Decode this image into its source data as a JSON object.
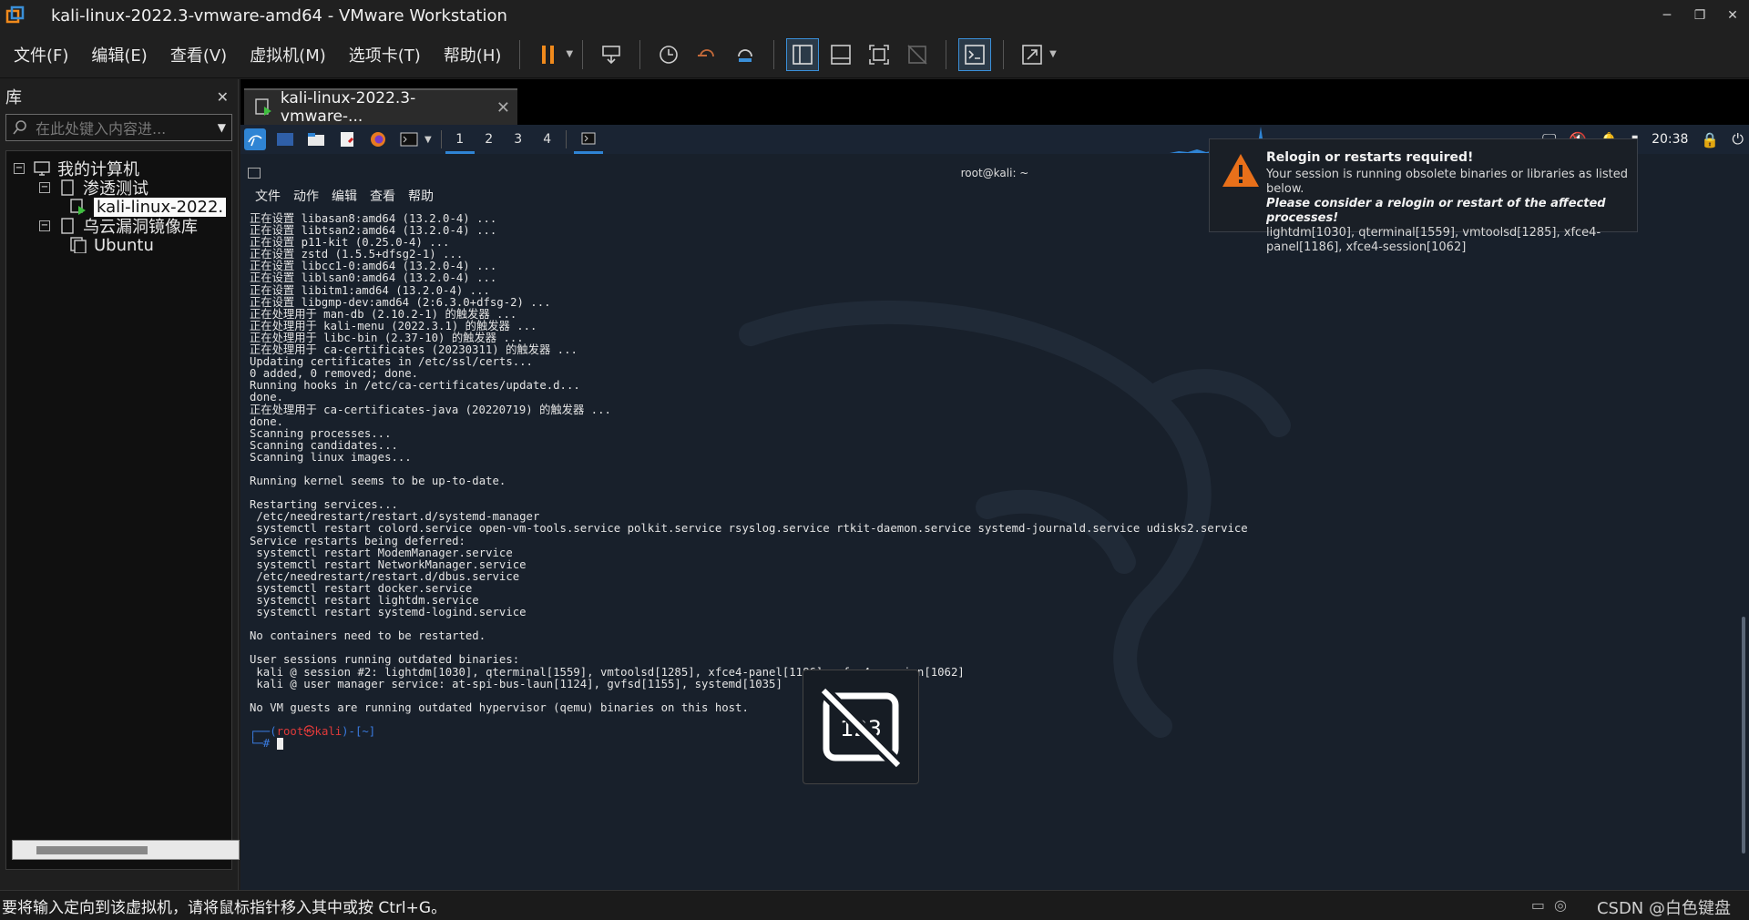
{
  "window": {
    "title": "kali-linux-2022.3-vmware-amd64 - VMware Workstation",
    "controls": [
      "minimize-icon",
      "restore-icon",
      "close-icon"
    ]
  },
  "menu": {
    "file": "文件(F)",
    "edit": "编辑(E)",
    "view": "查看(V)",
    "vm": "虚拟机(M)",
    "tabs": "选项卡(T)",
    "help": "帮助(H)"
  },
  "library": {
    "title": "库",
    "close": "✕",
    "search_placeholder": "在此处键入内容进...",
    "tree": {
      "root": "我的计算机",
      "folder1": "渗透测试",
      "vm1": "kali-linux-2022.",
      "folder2": "乌云漏洞镜像库",
      "vm2": "Ubuntu"
    }
  },
  "vm_tab": {
    "label": "kali-linux-2022.3-vmware-...",
    "close": "✕"
  },
  "kali_panel": {
    "workspaces": [
      "1",
      "2",
      "3",
      "4"
    ],
    "clock": "20:38"
  },
  "terminal": {
    "title": "root@kali: ~",
    "menu": [
      "文件",
      "动作",
      "编辑",
      "查看",
      "帮助"
    ],
    "lines": [
      "正在设置 libasan8:amd64 (13.2.0-4) ...",
      "正在设置 libtsan2:amd64 (13.2.0-4) ...",
      "正在设置 p11-kit (0.25.0-4) ...",
      "正在设置 zstd (1.5.5+dfsg2-1) ...",
      "正在设置 libcc1-0:amd64 (13.2.0-4) ...",
      "正在设置 liblsan0:amd64 (13.2.0-4) ...",
      "正在设置 libitm1:amd64 (13.2.0-4) ...",
      "正在设置 libgmp-dev:amd64 (2:6.3.0+dfsg-2) ...",
      "正在处理用于 man-db (2.10.2-1) 的触发器 ...",
      "正在处理用于 kali-menu (2022.3.1) 的触发器 ...",
      "正在处理用于 libc-bin (2.37-10) 的触发器 ...",
      "正在处理用于 ca-certificates (20230311) 的触发器 ...",
      "Updating certificates in /etc/ssl/certs...",
      "0 added, 0 removed; done.",
      "Running hooks in /etc/ca-certificates/update.d...",
      "done.",
      "正在处理用于 ca-certificates-java (20220719) 的触发器 ...",
      "done.",
      "Scanning processes...",
      "Scanning candidates...",
      "Scanning linux images...",
      "",
      "Running kernel seems to be up-to-date.",
      "",
      "Restarting services...",
      " /etc/needrestart/restart.d/systemd-manager",
      " systemctl restart colord.service open-vm-tools.service polkit.service rsyslog.service rtkit-daemon.service systemd-journald.service udisks2.service",
      "Service restarts being deferred:",
      " systemctl restart ModemManager.service",
      " systemctl restart NetworkManager.service",
      " /etc/needrestart/restart.d/dbus.service",
      " systemctl restart docker.service",
      " systemctl restart lightdm.service",
      " systemctl restart systemd-logind.service",
      "",
      "No containers need to be restarted.",
      "",
      "User sessions running outdated binaries:",
      " kali @ session #2: lightdm[1030], qterminal[1559], vmtoolsd[1285], xfce4-panel[1186], xfce4-session[1062]",
      " kali @ user manager service: at-spi-bus-laun[1124], gvfsd[1155], systemd[1035]",
      "",
      "No VM guests are running outdated hypervisor (qemu) binaries on this host.",
      ""
    ],
    "prompt_user": "root㉿kali",
    "prompt_dir": "~",
    "prompt_line1_pre": "┌──(",
    "prompt_line1_mid": ")-[",
    "prompt_line1_post": "]",
    "prompt_line2": "└─#"
  },
  "notification": {
    "title": "Relogin or restarts required!",
    "line1": "Your session is running obsolete binaries or libraries as listed below.",
    "line2": "Please consider a relogin or restart of the affected processes!",
    "line3": "lightdm[1030], qterminal[1559], vmtoolsd[1285], xfce4-panel[1186], xfce4-session[1062]"
  },
  "osd": {
    "label": "123"
  },
  "status": {
    "text": "要将输入定向到该虚拟机，请将鼠标指针移入其中或按 Ctrl+G。",
    "watermark": "CSDN @白色键盘"
  },
  "colors": {
    "accent": "#3a8fd8",
    "pause": "#f08a1c",
    "warning": "#e8701a"
  }
}
